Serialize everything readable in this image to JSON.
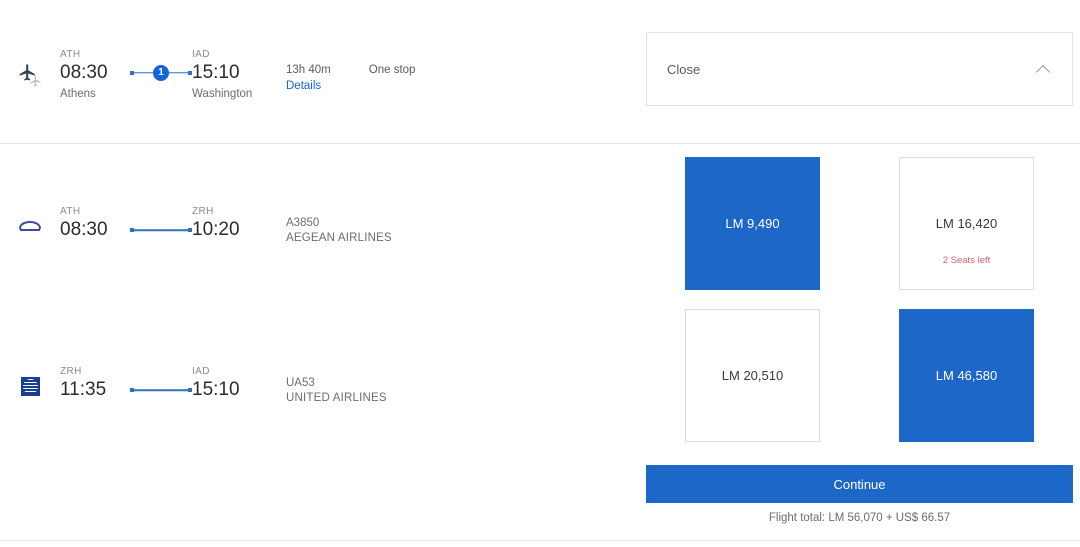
{
  "itinerary": {
    "summary": {
      "carrier_icon": "airplane-icon",
      "departure": {
        "code": "ATH",
        "time": "08:30",
        "city": "Athens"
      },
      "arrival": {
        "code": "IAD",
        "time": "15:10",
        "city": "Washington"
      },
      "stop_count": "1",
      "duration": "13h 40m",
      "stops_label": "One stop",
      "details_link": "Details"
    },
    "legs": [
      {
        "carrier_icon": "aegean-airlines-logo",
        "departure": {
          "code": "ATH",
          "time": "08:30"
        },
        "arrival": {
          "code": "ZRH",
          "time": "10:20"
        },
        "flight_number": "A3850",
        "carrier_name": "AEGEAN AIRLINES"
      },
      {
        "carrier_icon": "united-airlines-logo",
        "departure": {
          "code": "ZRH",
          "time": "11:35"
        },
        "arrival": {
          "code": "IAD",
          "time": "15:10"
        },
        "flight_number": "UA53",
        "carrier_name": "UNITED AIRLINES"
      }
    ]
  },
  "panel": {
    "close": {
      "label": "Close",
      "icon": "chevron-up-icon"
    },
    "fares": [
      {
        "price": "LM 9,490",
        "selected": true,
        "seats_left": ""
      },
      {
        "price": "LM 16,420",
        "selected": false,
        "seats_left": "2 Seats left"
      },
      {
        "price": "LM 20,510",
        "selected": false,
        "seats_left": ""
      },
      {
        "price": "LM 46,580",
        "selected": true,
        "seats_left": ""
      }
    ],
    "continue_label": "Continue",
    "total_label": "Flight total: LM 56,070 + US$ 66.57"
  },
  "colors": {
    "accent_blue": "#1d67c8",
    "link_blue": "#1565d8",
    "seats_red": "#d9606a",
    "divider": "#e6e6e8"
  }
}
